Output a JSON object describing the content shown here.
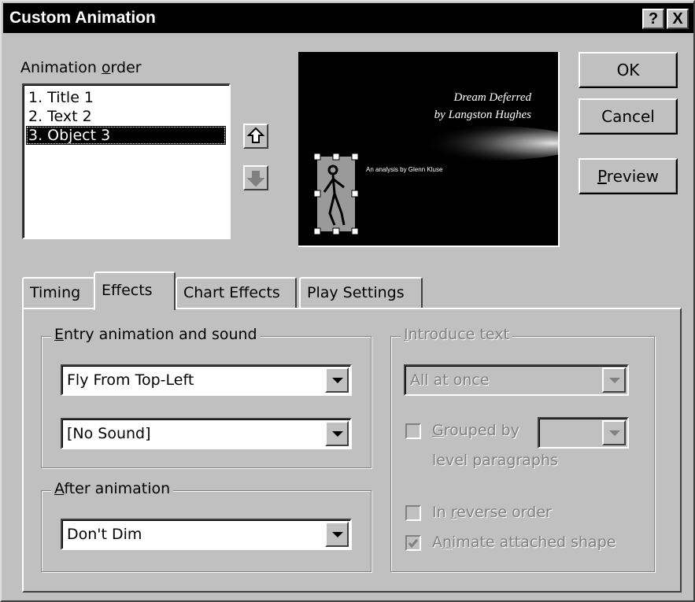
{
  "window": {
    "title": "Custom Animation",
    "help_button": "?",
    "close_button": "X"
  },
  "animation_order": {
    "label_pre": "Animation ",
    "label_accel": "o",
    "label_post": "rder",
    "items": [
      "1. Title 1",
      "2. Text 2",
      "3. Object 3"
    ],
    "selected_index": 2
  },
  "preview": {
    "title_line1": "Dream Deferred",
    "title_line2": "by Langston Hughes",
    "subtitle": "An analysis by Glenn Kluse"
  },
  "buttons": {
    "ok": "OK",
    "cancel": "Cancel",
    "preview_accel": "P",
    "preview_rest": "review"
  },
  "tabs": [
    "Timing",
    "Effects",
    "Chart Effects",
    "Play Settings"
  ],
  "active_tab": "Effects",
  "effects": {
    "entry_group": {
      "accel": "E",
      "rest": "ntry animation and sound"
    },
    "entry_effect": "Fly From Top-Left",
    "entry_sound": "[No Sound]",
    "after_group": {
      "accel": "A",
      "rest": "fter animation"
    },
    "after_value": "Don't Dim",
    "introduce_group": {
      "accel": "I",
      "rest": "ntroduce text"
    },
    "introduce_value": "All at once",
    "grouped_by": {
      "accel": "G",
      "rest": "rouped by"
    },
    "grouped_level": "level paragraphs",
    "reverse": {
      "pre": "In ",
      "accel": "r",
      "rest": "everse order"
    },
    "animate_attached": {
      "pre": "A",
      "accel": "n",
      "rest": "imate attached shape"
    }
  }
}
